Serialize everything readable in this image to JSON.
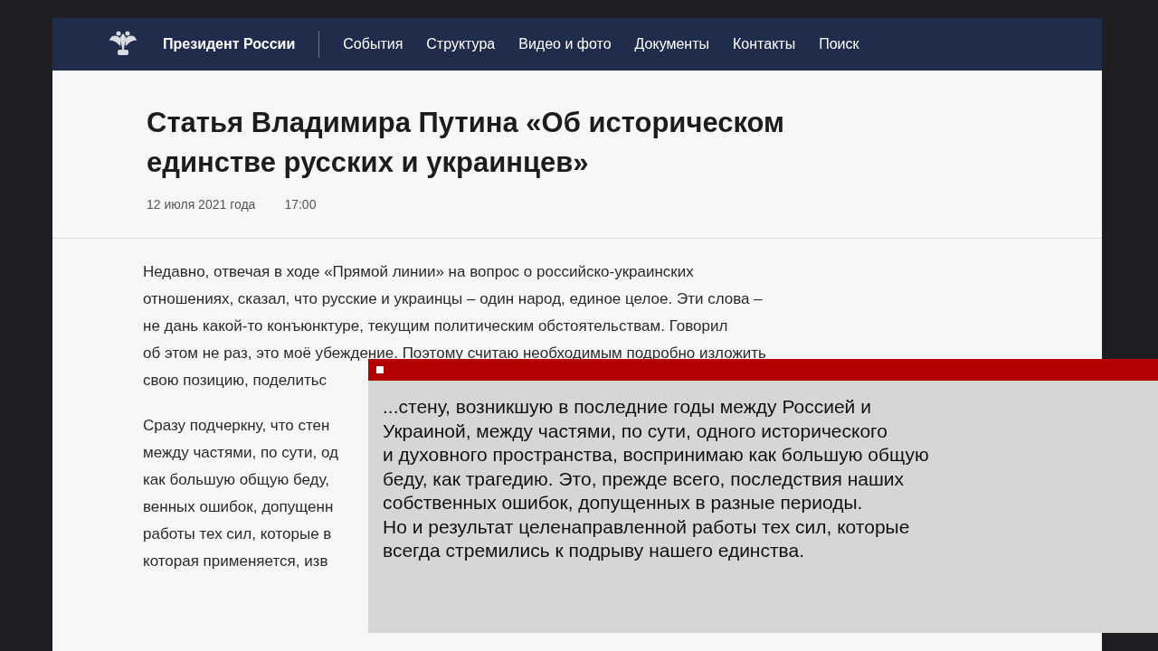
{
  "nav": {
    "site_title": "Президент России",
    "links": [
      "События",
      "Структура",
      "Видео и фото",
      "Документы",
      "Контакты",
      "Поиск"
    ]
  },
  "article": {
    "title": "Статья Владимира Путина «Об историческом единстве русских и украинцев»",
    "date": "12 июля 2021 года",
    "time": "17:00",
    "paragraphs": [
      [
        "Недавно, отвечая в ходе «Прямой линии» на вопрос о российско-украинских",
        "отношениях, сказал, что русские и украинцы – один народ, единое целое. Эти слова –",
        "не дань какой-то конъюнктуре, текущим политическим обстоятельствам. Говорил",
        "об этом не раз, это моё убеждение. Поэтому считаю необходимым подробно изложить",
        "свою позицию, поделитьс"
      ],
      [
        "Сразу подчеркну, что стен",
        "между частями, по сути, од",
        "как большую общую беду,",
        "венных ошибок, допущенн",
        "работы тех сил, которые в",
        "которая применяется, изв"
      ]
    ]
  },
  "caption": {
    "lines": [
      "...стену, возникшую в последние годы между Россией и",
      "Украиной, между частями, по сути, одного исторического",
      "и духовного пространства, воспринимаю как большую общую",
      "беду, как трагедию. Это, прежде всего, последствия наших",
      "собственных ошибок, допущенных в разные периоды.",
      "Но и результат целенаправленной работы тех сил, которые",
      "всегда стремились к подрыву нашего единства."
    ]
  }
}
